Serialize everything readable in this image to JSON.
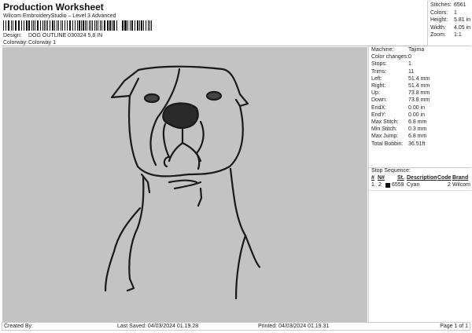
{
  "header": {
    "title": "Production Worksheet",
    "subtitle": "Wilcom EmbroideryStudio – Level 3 Advanced",
    "design_label": "Design:",
    "design": "DOG OUTLINE 030324 5,8 IN",
    "colorway_label": "Colorway:",
    "colorway": "Colorway 1"
  },
  "stats": [
    {
      "label": "Stitches:",
      "value": "6561"
    },
    {
      "label": "Colors:",
      "value": "1"
    },
    {
      "label": "Height:",
      "value": "5.81 in"
    },
    {
      "label": "Width:",
      "value": "4.05 in"
    },
    {
      "label": "Zoom:",
      "value": "1:1"
    }
  ],
  "machine": [
    {
      "label": "Machine:",
      "value": "Tajima"
    },
    {
      "label": "Color changes:",
      "value": "0"
    },
    {
      "label": "Stops:",
      "value": "1"
    },
    {
      "label": "Trims:",
      "value": "11"
    },
    {
      "label": "Left:",
      "value": "51.4 mm"
    },
    {
      "label": "Right:",
      "value": "51.4 mm"
    },
    {
      "label": "Up:",
      "value": "73.8 mm"
    },
    {
      "label": "Down:",
      "value": "73.8 mm"
    },
    {
      "label": "EndX:",
      "value": "0.00 in"
    },
    {
      "label": "EndY:",
      "value": "0.00 in"
    },
    {
      "label": "Max Stitch:",
      "value": "6.8 mm"
    },
    {
      "label": "Min Stitch:",
      "value": "0.3 mm"
    },
    {
      "label": "Max Jump:",
      "value": "6.8 mm"
    },
    {
      "label": "Total Bobbin:",
      "value": "36.51ft"
    }
  ],
  "stop_sequence": {
    "title": "Stop Sequence:",
    "headers": [
      "#",
      "N#",
      "St.",
      "Description",
      "Code",
      "Brand"
    ],
    "rows": [
      {
        "num": "1.",
        "n": "2",
        "color": "#111111",
        "st": "6559",
        "desc": "Cyan",
        "code": "2",
        "brand": "Wilcom"
      }
    ]
  },
  "footer": {
    "created": "Created By:",
    "saved": "Last Saved: 04/03/2024 01.19.28",
    "printed": "Printed: 04/03/2024 01.19.31",
    "page": "Page 1 of 1"
  }
}
